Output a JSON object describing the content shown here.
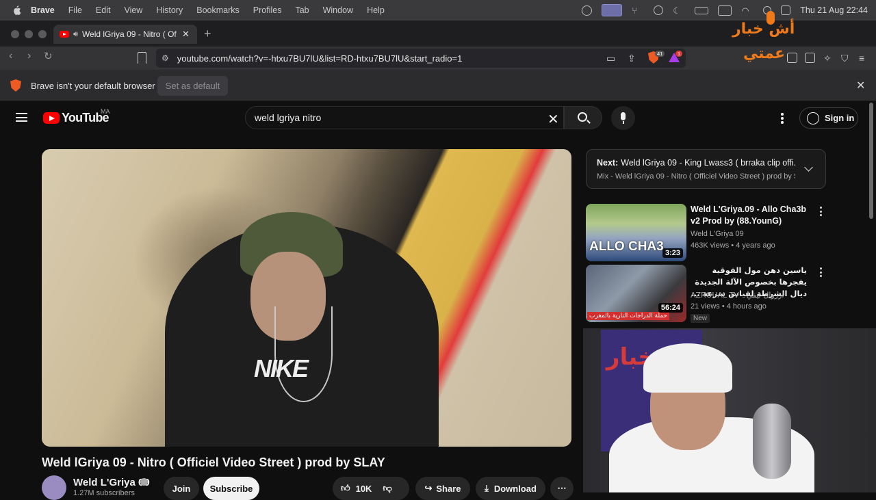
{
  "menubar": {
    "app": "Brave",
    "items": [
      "File",
      "Edit",
      "View",
      "History",
      "Bookmarks",
      "Profiles",
      "Tab",
      "Window",
      "Help"
    ],
    "clock": "Thu 21 Aug  22:44"
  },
  "tab": {
    "title": "Weld lGriya 09 - Nitro ( Offi",
    "new_tab": "+"
  },
  "address": {
    "url": "youtube.com/watch?v=-htxu7BU7lU&list=RD-htxu7BU7lU&start_radio=1",
    "shields_count": "41",
    "rewards_count": "1"
  },
  "default_bar": {
    "message": "Brave isn't your default browser",
    "button": "Set as default",
    "close": "✕"
  },
  "youtube": {
    "logo": "YouTube",
    "country": "MA",
    "search_value": "weld lgriya nitro",
    "clear": "✕",
    "sign_in": "Sign in"
  },
  "video": {
    "shirt_text": "NIKE",
    "title": "Weld lGriya 09 - Nitro ( Officiel Video Street ) prod by SLAY",
    "channel": "Weld L'Griya 09",
    "subs": "1.27M subscribers",
    "join": "Join",
    "subscribe": "Subscribe",
    "likes": "10K",
    "share": "Share",
    "download": "Download"
  },
  "next": {
    "label": "Next:",
    "title": "Weld lGriya 09 - King Lwass3 ( brraka clip offi...",
    "subtitle": "Mix - Weld lGriya 09 - Nitro ( Officiel Video Street ) prod by SL..."
  },
  "recs": [
    {
      "title": "Weld L'Griya.09 - Allo Cha3b v2 Prod by (88.YounG)",
      "channel": "Weld L'Griya 09",
      "meta": "463K views • 4 years ago",
      "duration": "3:23",
      "thumb_text": "ALLO CHA3"
    },
    {
      "title": "ياسين دهن مول الفوقية يفجرها بخصوص الآلة الجديدة ديال الشرطة لقياس سرعة ...",
      "channel": "AZROUAL TV - ازروال تيفي",
      "meta": "21 views • 4 hours ago",
      "duration": "56:24",
      "badge": "New",
      "thumb_text": "حملة الدراجات النارية بالمغرب"
    }
  ],
  "watermark": {
    "line1": "أش خبار",
    "line2": "عمتي"
  },
  "webcam": {
    "poster_text": "خبار"
  }
}
